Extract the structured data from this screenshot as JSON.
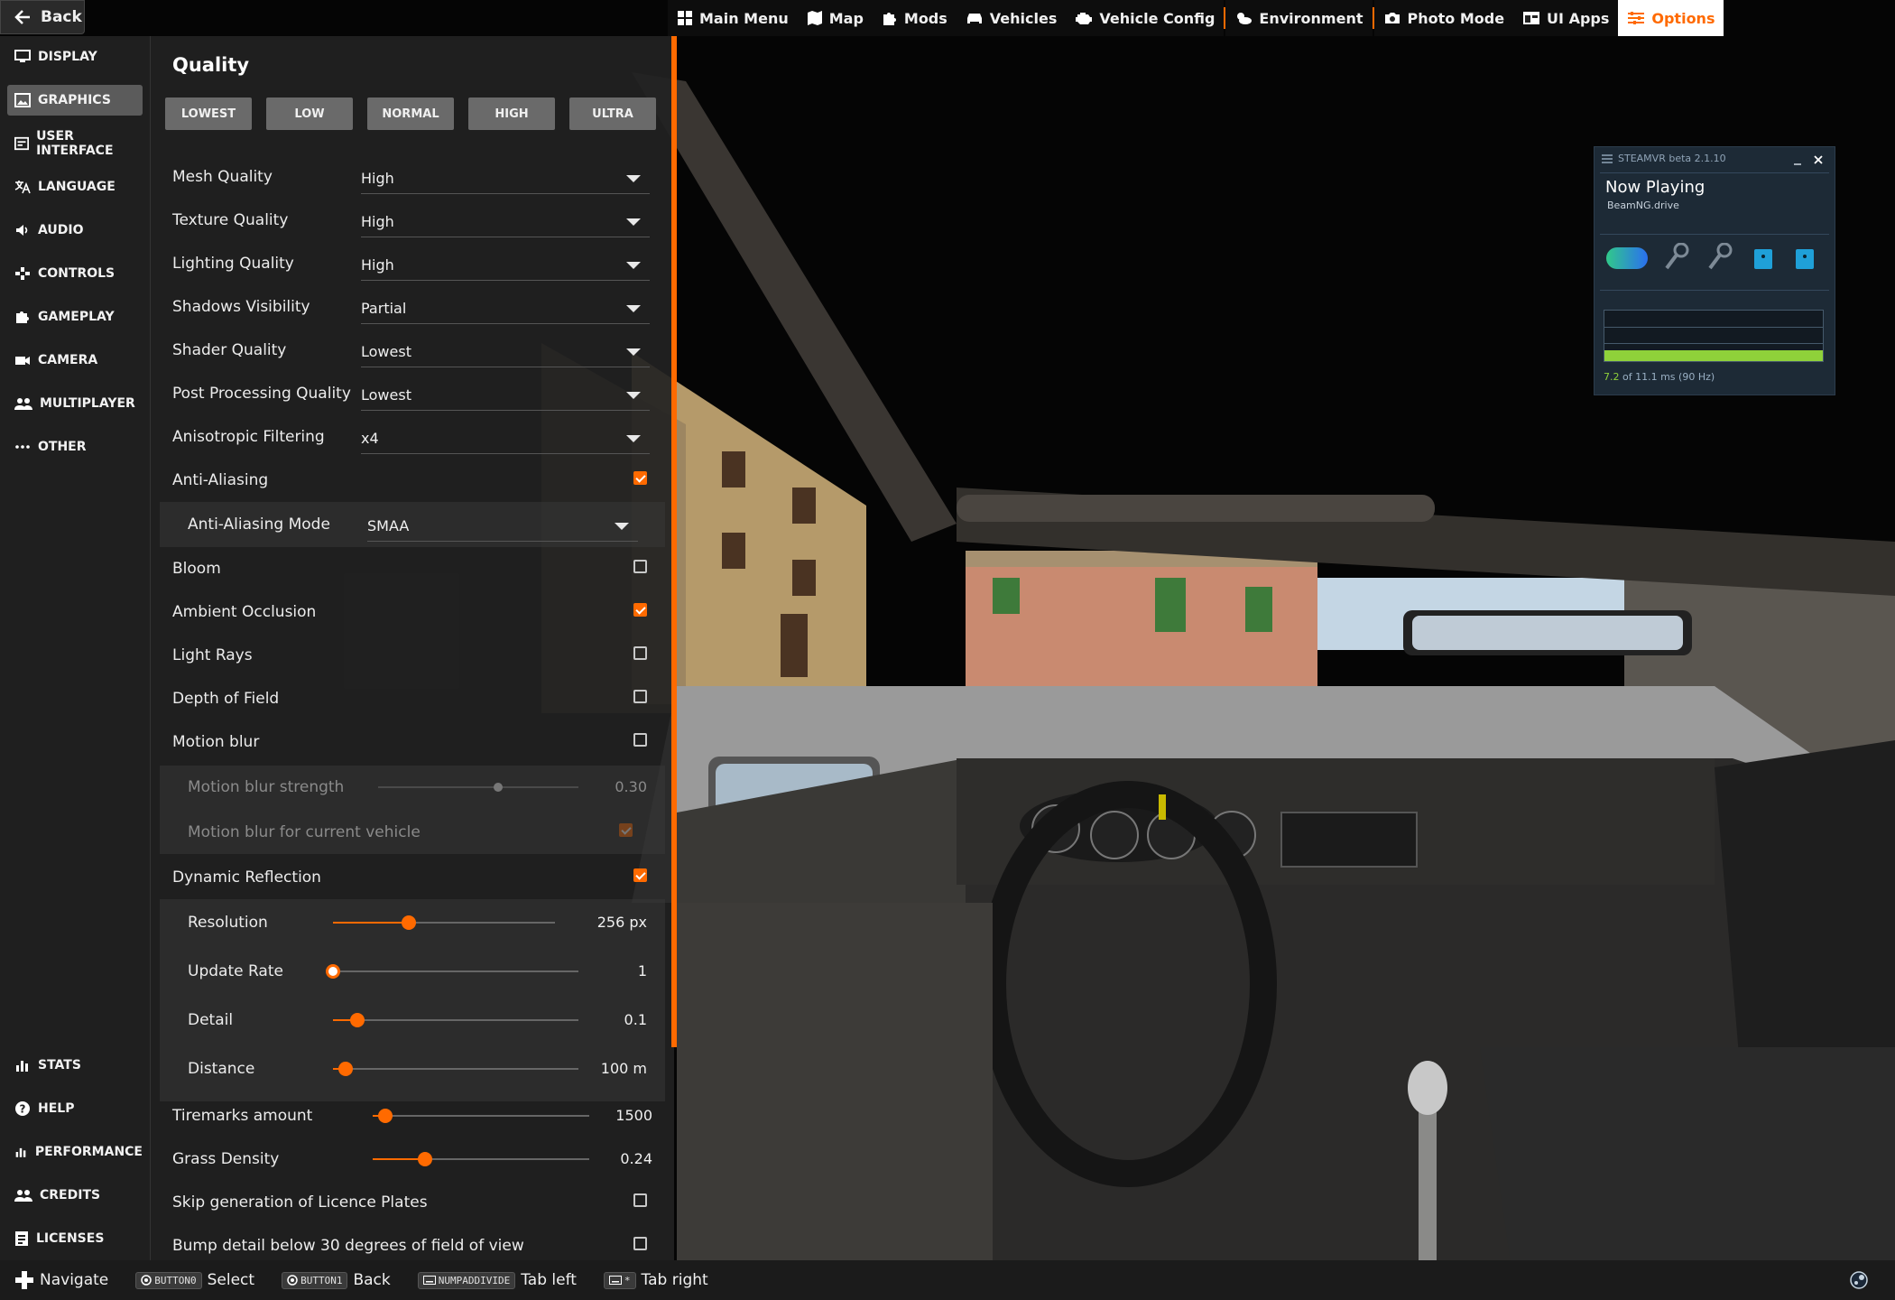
{
  "topbar": {
    "back_label": "Back",
    "nav": [
      {
        "label": "Main Menu",
        "icon": "main-menu-icon"
      },
      {
        "label": "Map",
        "icon": "map-icon"
      },
      {
        "label": "Mods",
        "icon": "puzzle-icon"
      },
      {
        "label": "Vehicles",
        "icon": "car-icon"
      },
      {
        "label": "Vehicle Config",
        "icon": "engine-icon"
      },
      {
        "label": "Environment",
        "icon": "weather-icon"
      },
      {
        "label": "Photo Mode",
        "icon": "camera-icon"
      },
      {
        "label": "UI Apps",
        "icon": "apps-icon"
      },
      {
        "label": "Options",
        "icon": "sliders-icon",
        "active": true
      }
    ]
  },
  "sidebar": {
    "items": [
      {
        "label": "DISPLAY",
        "icon": "monitor-icon"
      },
      {
        "label": "GRAPHICS",
        "icon": "image-icon",
        "active": true
      },
      {
        "label": "USER INTERFACE",
        "icon": "ui-icon"
      },
      {
        "label": "LANGUAGE",
        "icon": "translate-icon"
      },
      {
        "label": "AUDIO",
        "icon": "speaker-icon"
      },
      {
        "label": "CONTROLS",
        "icon": "gamepad-icon"
      },
      {
        "label": "GAMEPLAY",
        "icon": "puzzle-icon"
      },
      {
        "label": "CAMERA",
        "icon": "video-camera-icon"
      },
      {
        "label": "MULTIPLAYER",
        "icon": "people-icon"
      },
      {
        "label": "OTHER",
        "icon": "more-icon"
      }
    ],
    "bottom_items": [
      {
        "label": "STATS",
        "icon": "bar-chart-icon"
      },
      {
        "label": "HELP",
        "icon": "help-icon"
      },
      {
        "label": "PERFORMANCE",
        "icon": "bar-chart-icon"
      },
      {
        "label": "CREDITS",
        "icon": "people-icon"
      },
      {
        "label": "LICENSES",
        "icon": "license-icon"
      }
    ]
  },
  "quality": {
    "title": "Quality",
    "presets": [
      "LOWEST",
      "LOW",
      "NORMAL",
      "HIGH",
      "ULTRA"
    ],
    "dropdowns": [
      {
        "label": "Mesh Quality",
        "value": "High"
      },
      {
        "label": "Texture Quality",
        "value": "High"
      },
      {
        "label": "Lighting Quality",
        "value": "High"
      },
      {
        "label": "Shadows Visibility",
        "value": "Partial"
      },
      {
        "label": "Shader Quality",
        "value": "Lowest"
      },
      {
        "label": "Post Processing Quality",
        "value": "Lowest"
      },
      {
        "label": "Anisotropic Filtering",
        "value": "x4"
      }
    ],
    "anti_aliasing": {
      "label": "Anti-Aliasing",
      "checked": true
    },
    "anti_aliasing_mode": {
      "label": "Anti-Aliasing Mode",
      "value": "SMAA"
    },
    "toggles": [
      {
        "label": "Bloom",
        "checked": false
      },
      {
        "label": "Ambient Occlusion",
        "checked": true
      },
      {
        "label": "Light Rays",
        "checked": false
      },
      {
        "label": "Depth of Field",
        "checked": false
      },
      {
        "label": "Motion blur",
        "checked": false
      }
    ],
    "motion_blur_strength": {
      "label": "Motion blur strength",
      "value": "0.30",
      "fraction": 0.6
    },
    "motion_blur_vehicle": {
      "label": "Motion blur for current vehicle",
      "checked": true
    },
    "dynamic_reflection": {
      "label": "Dynamic Reflection",
      "checked": true
    },
    "reflection_sliders": [
      {
        "label": "Resolution",
        "value": "256 px",
        "fraction": 0.34
      },
      {
        "label": "Update Rate",
        "value": "1",
        "fraction": 0.0
      },
      {
        "label": "Detail",
        "value": "0.1",
        "fraction": 0.1
      },
      {
        "label": "Distance",
        "value": "100 m",
        "fraction": 0.05
      }
    ],
    "tiremarks": {
      "label": "Tiremarks amount",
      "value": "1500",
      "fraction": 0.06
    },
    "grass": {
      "label": "Grass Density",
      "value": "0.24",
      "fraction": 0.24
    },
    "licence_plates": {
      "label": "Skip generation of Licence Plates",
      "checked": false
    },
    "bump_detail": {
      "label": "Bump detail below 30 degrees of field of view",
      "checked": false
    }
  },
  "steamvr": {
    "header": "STEAMVR beta 2.1.10",
    "now_playing": "Now Playing",
    "game": "BeamNG.drive",
    "frame_time": "7.2",
    "frame_budget": "of 11.1 ms (90 Hz)"
  },
  "bottombar": {
    "items": [
      {
        "key": "",
        "label": "Navigate"
      },
      {
        "key": "BUTTON0",
        "label": "Select"
      },
      {
        "key": "BUTTON1",
        "label": "Back"
      },
      {
        "key": "NUMPADDIVIDE",
        "label": "Tab left"
      },
      {
        "key": "*",
        "label": "Tab right"
      }
    ]
  },
  "colors": {
    "accent": "#ff6a00",
    "panel": "#222222",
    "sidebar": "#1f1f1f",
    "graph": "#8fd13a"
  }
}
